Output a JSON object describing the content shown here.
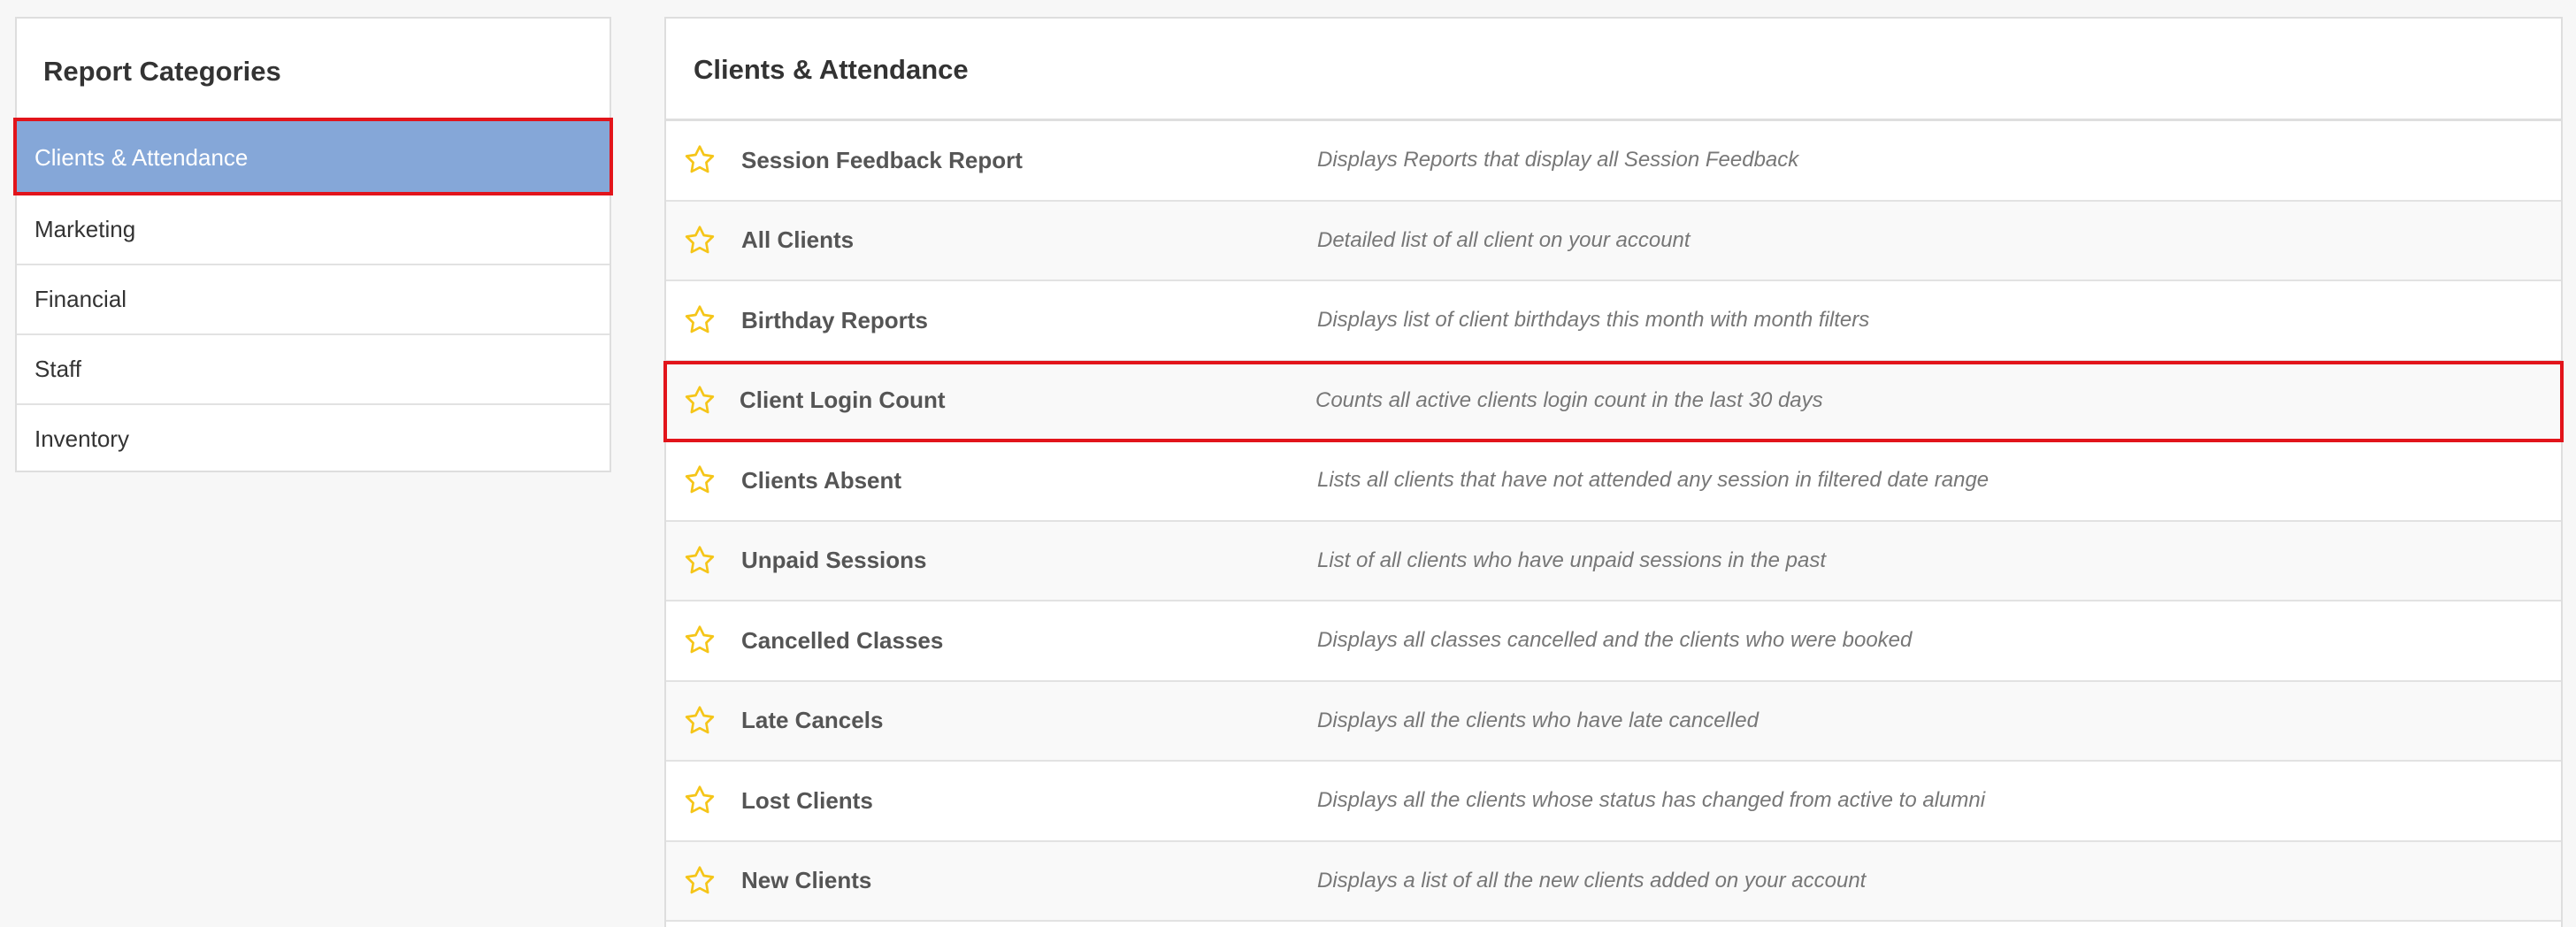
{
  "sidebar": {
    "title": "Report Categories",
    "items": [
      {
        "label": "Clients & Attendance",
        "active": true
      },
      {
        "label": "Marketing",
        "active": false
      },
      {
        "label": "Financial",
        "active": false
      },
      {
        "label": "Staff",
        "active": false
      },
      {
        "label": "Inventory",
        "active": false
      }
    ]
  },
  "main": {
    "title": "Clients & Attendance",
    "reports": [
      {
        "name": "Session Feedback Report",
        "description": "Displays Reports that display all Session Feedback"
      },
      {
        "name": "All Clients",
        "description": "Detailed list of all client on your account"
      },
      {
        "name": "Birthday Reports",
        "description": "Displays list of client birthdays this month with month filters"
      },
      {
        "name": "Client Login Count",
        "description": "Counts all active clients login count in the last 30 days"
      },
      {
        "name": "Clients Absent",
        "description": "Lists all clients that have not attended any session in filtered date range"
      },
      {
        "name": "Unpaid Sessions",
        "description": "List of all clients who have unpaid sessions in the past"
      },
      {
        "name": "Cancelled Classes",
        "description": "Displays all classes cancelled and the clients who were booked"
      },
      {
        "name": "Late Cancels",
        "description": "Displays all the clients who have late cancelled"
      },
      {
        "name": "Lost Clients",
        "description": "Displays all the clients whose status has changed from active to alumni"
      },
      {
        "name": "New Clients",
        "description": "Displays a list of all the new clients added on your account"
      }
    ]
  },
  "colors": {
    "active_bg": "#85a7d8",
    "highlight_border": "#e2141b",
    "star": "#f5c518"
  },
  "icons": {
    "favorite": "star-outline-icon"
  }
}
